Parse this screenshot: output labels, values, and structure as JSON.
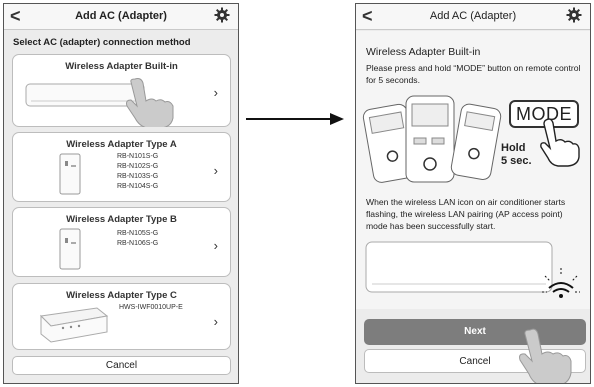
{
  "left_screen": {
    "title": "Add AC (Adapter)",
    "back_icon": "chevron-left-icon",
    "settings_icon": "gear-icon",
    "section_title": "Select AC (adapter) connection method",
    "cards": [
      {
        "title": "Wireless Adapter Built-in",
        "models": []
      },
      {
        "title": "Wireless Adapter Type A",
        "models": [
          "RB-N101S-G",
          "RB-N102S-G",
          "RB-N103S-G",
          "RB-N104S-G"
        ]
      },
      {
        "title": "Wireless Adapter Type B",
        "models": [
          "RB-N105S-G",
          "RB-N106S-G"
        ]
      },
      {
        "title": "Wireless Adapter Type C",
        "models": [
          "HWS-IWF0010UP-E"
        ]
      }
    ],
    "cancel_label": "Cancel"
  },
  "right_screen": {
    "title": "Add AC (Adapter)",
    "back_icon": "chevron-left-icon",
    "settings_icon": "gear-icon",
    "heading": "Wireless Adapter Built-in",
    "instruction": "Please press and hold “MODE” button on remote control for 5 seconds.",
    "mode_label": "MODE",
    "hold_line1": "Hold",
    "hold_line2": "5 sec.",
    "status_text": "When the wireless LAN icon on air conditioner starts flashing, the wireless LAN pairing (AP access point) mode has been successfully start.",
    "next_label": "Next",
    "cancel_label": "Cancel"
  },
  "chevron": "›",
  "back_glyph": "<",
  "colors": {
    "next_button": "#7d7d7d",
    "background": "#ececec",
    "card": "#ffffff"
  }
}
